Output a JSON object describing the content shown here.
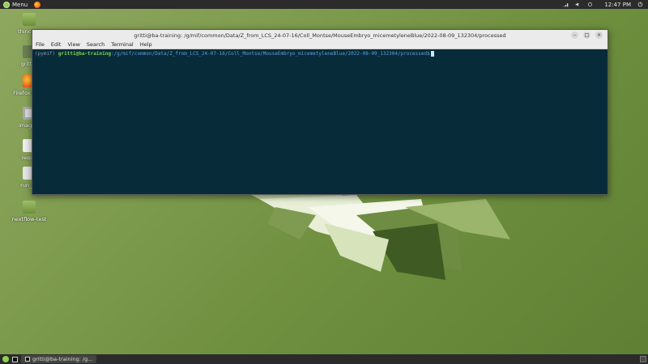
{
  "top_panel": {
    "menu_label": "Menu",
    "clock": "12:47 PM"
  },
  "desktop_icons": [
    {
      "label": "thincsen"
    },
    {
      "label": "gritti's"
    },
    {
      "label": "Firefox Brow"
    },
    {
      "label": "image.F"
    },
    {
      "label": "requir"
    },
    {
      "label": "run_ila"
    },
    {
      "label": "nextflow-test"
    }
  ],
  "terminal": {
    "title": "gritti@ba-training: /g/mif/common/Data/Z_from_LCS_24-07-16/Coll_Montse/MouseEmbryo_micemetyleneBlue/2022-08-09_132304/processed",
    "menu": [
      "File",
      "Edit",
      "View",
      "Search",
      "Terminal",
      "Help"
    ],
    "prompt_env": "(pymif)",
    "prompt_user": "gritti@ba-training",
    "prompt_path": ":/g/mif/common/Data/Z_from_LCS_24-07-16/Coll_Montse/MouseEmbryo_micemetyleneBlue/2022-08-09_132304/processed$"
  },
  "bottom_panel": {
    "task_label": "gritti@ba-training: /g..."
  }
}
